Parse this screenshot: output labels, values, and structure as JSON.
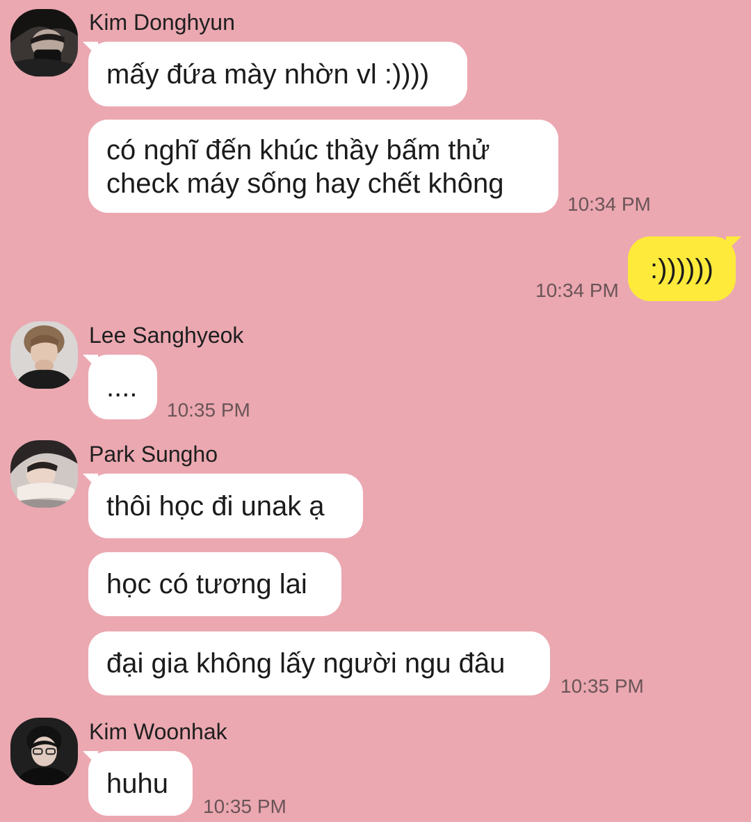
{
  "messages": [
    {
      "sender": "Kim Donghyun",
      "bubbles": [
        "mấy đứa mày nhờn vl :))))",
        "có nghĩ đến khúc thầy bấm thử check máy sống hay chết không"
      ],
      "time": "10:34 PM"
    },
    {
      "sender": "me",
      "bubbles": [
        ":))))))"
      ],
      "time": "10:34 PM"
    },
    {
      "sender": "Lee Sanghyeok",
      "bubbles": [
        "...."
      ],
      "time": "10:35 PM"
    },
    {
      "sender": "Park Sungho",
      "bubbles": [
        "thôi học đi unak ạ",
        "học có tương lai",
        "đại gia không lấy người ngu đâu"
      ],
      "time": "10:35 PM"
    },
    {
      "sender": "Kim Woonhak",
      "bubbles": [
        "huhu"
      ],
      "time": "10:35 PM"
    }
  ],
  "colors": {
    "background": "#eba8b1",
    "incoming_bubble": "#ffffff",
    "outgoing_bubble": "#fdea3b",
    "timestamp": "#6a5457"
  },
  "icons": {
    "avatar_1": "profile-photo",
    "avatar_2": "profile-photo",
    "avatar_3": "profile-photo",
    "avatar_4": "profile-photo"
  }
}
